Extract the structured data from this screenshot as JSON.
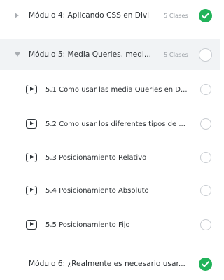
{
  "modules": [
    {
      "title": "Módulo 4: Aplicando CSS en Divi",
      "count": "5 Clases",
      "status": "completed"
    },
    {
      "title": "Módulo 5: Media Queries, medi...",
      "count": "5 Clases",
      "status": "incomplete",
      "expanded": true
    },
    {
      "title": "Módulo 6: ¿Realmente es necesario usar...",
      "status": "completed"
    }
  ],
  "lessons": [
    {
      "title": "5.1 Como usar las media Queries en D...",
      "status": "incomplete",
      "icon": "play-icon"
    },
    {
      "title": "5.2 Como usar los diferentes tipos de ...",
      "status": "incomplete",
      "icon": "play-icon"
    },
    {
      "title": "5.3 Posicionamiento Relativo",
      "status": "incomplete",
      "icon": "play-icon"
    },
    {
      "title": "5.4 Posicionamiento Absoluto",
      "status": "incomplete",
      "icon": "play-icon"
    },
    {
      "title": "5.5 Posicionamiento Fijo",
      "status": "incomplete",
      "icon": "play-icon"
    }
  ],
  "colors": {
    "completed": "#21b35a",
    "active_row_bg": "#f1f3f5",
    "muted_text": "#9ba0a6"
  }
}
